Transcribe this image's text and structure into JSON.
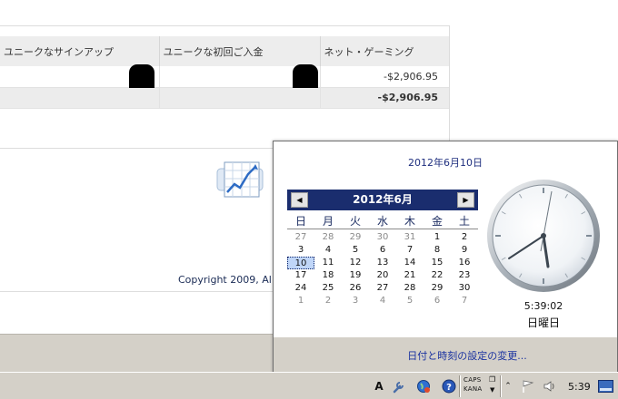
{
  "report": {
    "headers": [
      "ユニークなサインアップ",
      "ユニークな初回ご入金",
      "ネット・ゲーミング"
    ],
    "rows": [
      {
        "net_gaming": "-$2,906.95"
      },
      {
        "net_gaming": "-$2,906.95"
      }
    ]
  },
  "footer": {
    "copyright": "Copyright 2009, Al"
  },
  "popup": {
    "full_date": "2012年6月10日",
    "calendar": {
      "month_title": "2012年6月",
      "prev_symbol": "◀",
      "next_symbol": "▶",
      "weekdays": [
        "日",
        "月",
        "火",
        "水",
        "木",
        "金",
        "土"
      ],
      "selected_day": "10",
      "days": [
        {
          "d": "27",
          "other": true
        },
        {
          "d": "28",
          "other": true
        },
        {
          "d": "29",
          "other": true
        },
        {
          "d": "30",
          "other": true
        },
        {
          "d": "31",
          "other": true
        },
        {
          "d": "1",
          "other": false
        },
        {
          "d": "2",
          "other": false
        },
        {
          "d": "3",
          "other": false
        },
        {
          "d": "4",
          "other": false
        },
        {
          "d": "5",
          "other": false
        },
        {
          "d": "6",
          "other": false
        },
        {
          "d": "7",
          "other": false
        },
        {
          "d": "8",
          "other": false
        },
        {
          "d": "9",
          "other": false
        },
        {
          "d": "10",
          "other": false
        },
        {
          "d": "11",
          "other": false
        },
        {
          "d": "12",
          "other": false
        },
        {
          "d": "13",
          "other": false
        },
        {
          "d": "14",
          "other": false
        },
        {
          "d": "15",
          "other": false
        },
        {
          "d": "16",
          "other": false
        },
        {
          "d": "17",
          "other": false
        },
        {
          "d": "18",
          "other": false
        },
        {
          "d": "19",
          "other": false
        },
        {
          "d": "20",
          "other": false
        },
        {
          "d": "21",
          "other": false
        },
        {
          "d": "22",
          "other": false
        },
        {
          "d": "23",
          "other": false
        },
        {
          "d": "24",
          "other": false
        },
        {
          "d": "25",
          "other": false
        },
        {
          "d": "26",
          "other": false
        },
        {
          "d": "27",
          "other": false
        },
        {
          "d": "28",
          "other": false
        },
        {
          "d": "29",
          "other": false
        },
        {
          "d": "30",
          "other": false
        },
        {
          "d": "1",
          "other": true
        },
        {
          "d": "2",
          "other": true
        },
        {
          "d": "3",
          "other": true
        },
        {
          "d": "4",
          "other": true
        },
        {
          "d": "5",
          "other": true
        },
        {
          "d": "6",
          "other": true
        },
        {
          "d": "7",
          "other": true
        }
      ]
    },
    "clock": {
      "time": "5:39:02",
      "weekday": "日曜日"
    },
    "settings_link": "日付と時刻の設定の変更..."
  },
  "taskbar": {
    "ime_letter": "A",
    "caps_label": "CAPS",
    "kana_label": "KANA",
    "time": "5:39",
    "icons": [
      "ime-a-icon",
      "wrench-icon",
      "network-globe-icon",
      "help-icon",
      "flag-icon",
      "speaker-icon",
      "show-desktop-icon"
    ]
  }
}
